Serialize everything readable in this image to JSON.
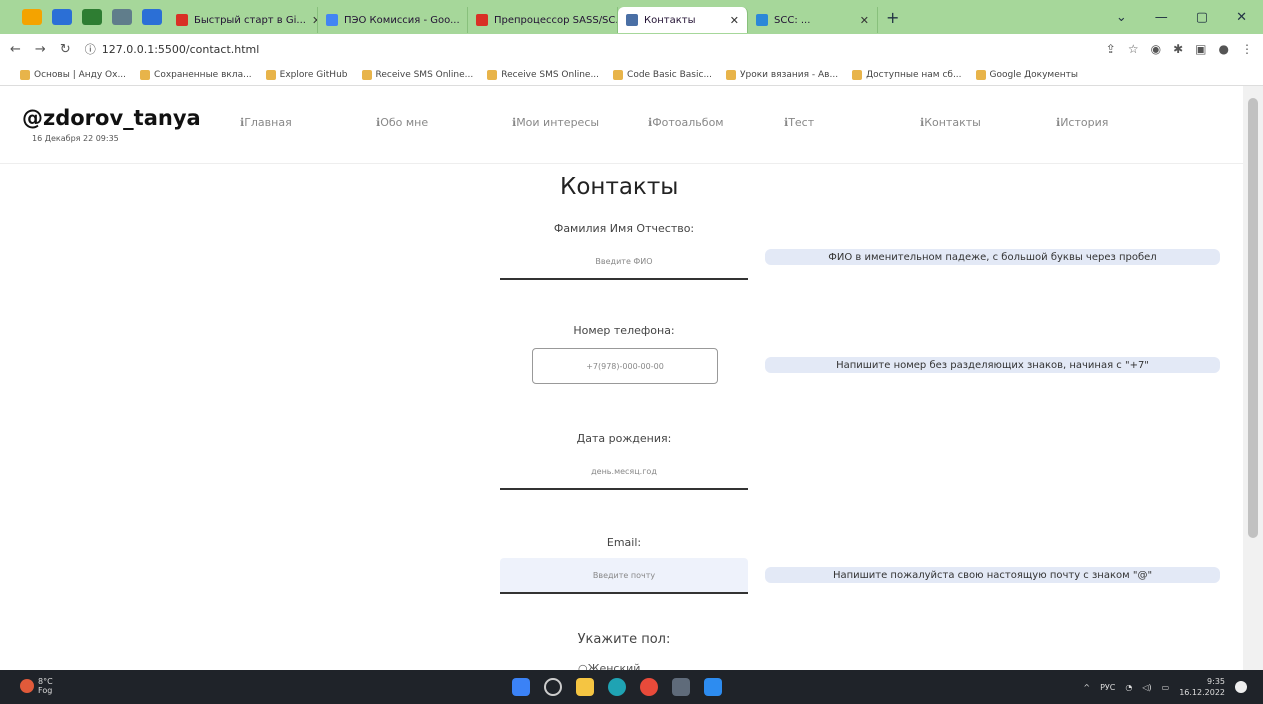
{
  "browser": {
    "tabs": [
      {
        "label": "Быстрый старт в Gi...",
        "color": "#d93025",
        "active": false
      },
      {
        "label": "ПЭО Комиссия - Goo...",
        "color": "#4285f4",
        "active": false
      },
      {
        "label": "Препроцессор SASS/SC...",
        "color": "#d93025",
        "active": false
      },
      {
        "label": "Контакты",
        "color": "#4a6fa5",
        "active": true
      },
      {
        "label": "SCC: ...",
        "color": "#2b88d8",
        "active": false
      }
    ],
    "url": "127.0.0.1:5500/contact.html",
    "bookmarks": [
      "Основы | Андy Ox...",
      "Сохраненные вкла...",
      "Explore GitHub",
      "Receive SMS Online...",
      "Receive SMS Online...",
      "Code Basic Basic...",
      "Уроки вязания - Ав...",
      "Доступные нам сб...",
      "Google Документы"
    ]
  },
  "site": {
    "brand": "@zdorov_tanya",
    "date": "16 Декабря 22 09:35",
    "menu": [
      "Главная",
      "Обо мне",
      "Мои интересы",
      "Фотоальбом",
      "Тест",
      "Контакты",
      "История"
    ]
  },
  "form": {
    "title": "Контакты",
    "fio_label": "Фамилия Имя Отчество:",
    "fio_placeholder": "Введите ФИО",
    "fio_hint": "ФИО в именительном падеже, с большой буквы через пробел",
    "phone_label": "Номер телефона:",
    "phone_placeholder": "+7(978)-000-00-00",
    "phone_hint": "Напишите номер без разделяющих знаков, начиная с \"+7\"",
    "birth_label": "Дата рождения:",
    "birth_placeholder": "день.месяц.год",
    "email_label": "Email:",
    "email_placeholder": "Введите почту",
    "email_hint": "Напишите пожалуйста свою настоящую почту с знаком \"@\"",
    "gender_label": "Укажите пол:",
    "gender_option": "Женский"
  },
  "taskbar": {
    "weather_temp": "8°C",
    "weather_text": "Fog",
    "lang": "РУС",
    "time": "9:35",
    "date": "16.12.2022"
  }
}
